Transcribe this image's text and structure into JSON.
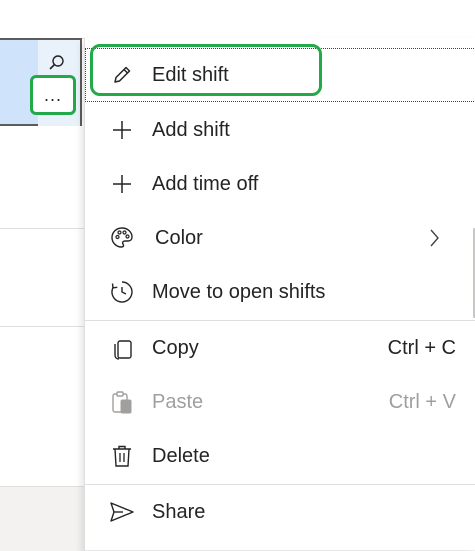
{
  "shift_cell": {
    "more_label": "..."
  },
  "menu": {
    "items": [
      {
        "label": "Edit shift",
        "icon": "pencil-icon"
      },
      {
        "label": "Add shift",
        "icon": "plus-icon"
      },
      {
        "label": "Add time off",
        "icon": "plus-icon"
      },
      {
        "label": "Color",
        "icon": "palette-icon",
        "submenu": true
      },
      {
        "label": "Move to open shifts",
        "icon": "clock-icon"
      },
      {
        "label": "Copy",
        "icon": "copy-icon",
        "shortcut": "Ctrl + C"
      },
      {
        "label": "Paste",
        "icon": "paste-icon",
        "shortcut": "Ctrl + V",
        "disabled": true
      },
      {
        "label": "Delete",
        "icon": "trash-icon"
      },
      {
        "label": "Share",
        "icon": "send-icon"
      }
    ]
  },
  "colors": {
    "highlight_green": "#23a84a",
    "selected_cell": "#cfe4fa",
    "disabled_text": "#a19f9d"
  }
}
